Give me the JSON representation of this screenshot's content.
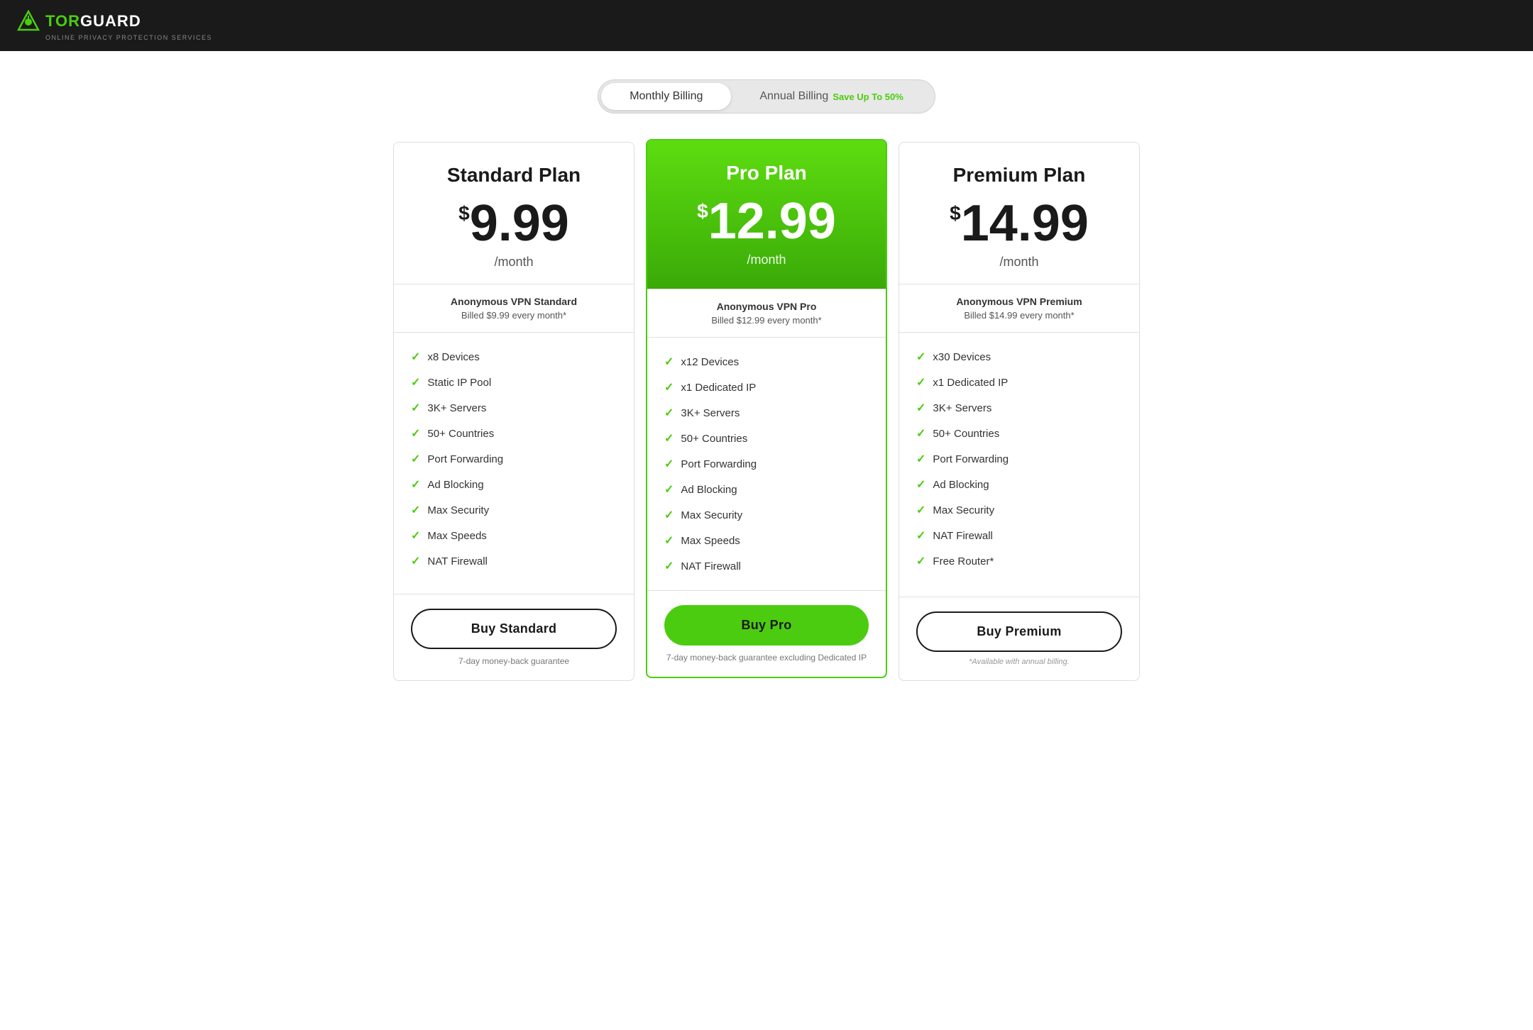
{
  "header": {
    "logo_tor": "TOR",
    "logo_guard": "GUARD",
    "logo_subtitle": "ONLINE PRIVACY PROTECTION SERVICES"
  },
  "billing_toggle": {
    "monthly_label": "Monthly Billing",
    "annual_label": "Annual Billing",
    "annual_save": "Save Up To 50%",
    "active": "monthly"
  },
  "plans": [
    {
      "id": "standard",
      "name": "Standard Plan",
      "featured": false,
      "price_dollar": "$",
      "price_amount": "9.99",
      "price_period": "/month",
      "product_name": "Anonymous VPN Standard",
      "billed_text": "Billed $9.99 every month*",
      "features": [
        "x8 Devices",
        "Static IP Pool",
        "3K+ Servers",
        "50+ Countries",
        "Port Forwarding",
        "Ad Blocking",
        "Max Security",
        "Max Speeds",
        "NAT Firewall"
      ],
      "button_label": "Buy Standard",
      "guarantee": "7-day money-back guarantee",
      "note": ""
    },
    {
      "id": "pro",
      "name": "Pro Plan",
      "featured": true,
      "price_dollar": "$",
      "price_amount": "12.99",
      "price_period": "/month",
      "product_name": "Anonymous VPN Pro",
      "billed_text": "Billed $12.99 every month*",
      "features": [
        "x12 Devices",
        "x1 Dedicated IP",
        "3K+ Servers",
        "50+ Countries",
        "Port Forwarding",
        "Ad Blocking",
        "Max Security",
        "Max Speeds",
        "NAT Firewall"
      ],
      "button_label": "Buy Pro",
      "guarantee": "7-day money-back guarantee excluding Dedicated IP",
      "note": ""
    },
    {
      "id": "premium",
      "name": "Premium Plan",
      "featured": false,
      "price_dollar": "$",
      "price_amount": "14.99",
      "price_period": "/month",
      "product_name": "Anonymous VPN Premium",
      "billed_text": "Billed $14.99 every month*",
      "features": [
        "x30 Devices",
        "x1 Dedicated IP",
        "3K+ Servers",
        "50+ Countries",
        "Port Forwarding",
        "Ad Blocking",
        "Max Security",
        "NAT Firewall",
        "Free Router*"
      ],
      "button_label": "Buy Premium",
      "guarantee": "",
      "note": "*Available with annual billing."
    }
  ]
}
